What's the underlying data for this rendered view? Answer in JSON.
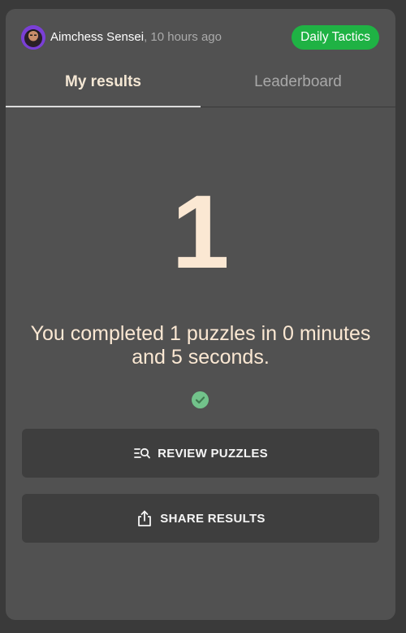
{
  "header": {
    "author_name": "Aimchess Sensei",
    "time_ago": ", 10 hours ago",
    "badge_label": "Daily Tactics"
  },
  "tabs": [
    {
      "label": "My results",
      "active": true
    },
    {
      "label": "Leaderboard",
      "active": false
    }
  ],
  "result": {
    "count": "1",
    "summary": "You completed 1 puzzles in 0 minutes and 5 seconds."
  },
  "actions": {
    "review_label": "REVIEW PUZZLES",
    "share_label": "SHARE RESULTS"
  },
  "icons": {
    "avatar": "avatar-icon",
    "check": "check-circle-icon",
    "review": "list-search-icon",
    "share": "share-icon"
  },
  "colors": {
    "badge": "#1fb244",
    "accent_text": "#fbe8d3",
    "check": "#72c38b"
  }
}
